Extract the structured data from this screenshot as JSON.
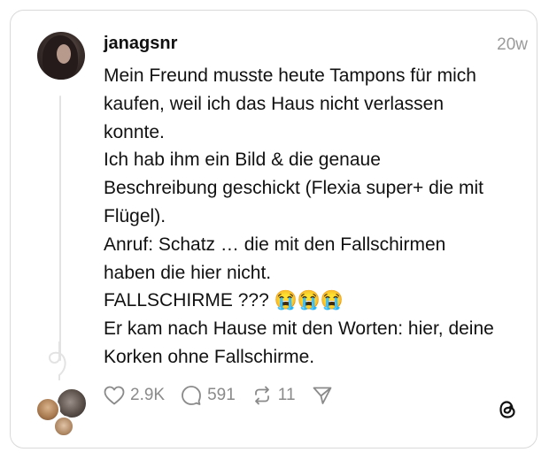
{
  "post": {
    "username": "janagsnr",
    "time": "20w",
    "text": "Mein Freund musste heute Tampons für mich\nkaufen, weil ich das Haus nicht verlassen\nkonnte.\nIch hab ihm ein Bild & die genaue\nBeschreibung geschickt (Flexia super+ die mit\nFlügel).\nAnruf: Schatz … die mit den Fallschirmen\nhaben die hier nicht.\nFALLSCHIRME ??? 😭😭😭\nEr kam nach Hause mit den Worten: hier, deine\nKorken ohne Fallschirme."
  },
  "actions": {
    "likes": "2.9K",
    "replies": "591",
    "reposts": "11"
  },
  "icons": {
    "like": "heart-icon",
    "reply": "speech-bubble-icon",
    "repost": "repost-icon",
    "share": "send-icon",
    "brand": "threads-logo"
  },
  "colors": {
    "text": "#111111",
    "muted": "#8a8a8a",
    "border": "#d9d9d9"
  }
}
